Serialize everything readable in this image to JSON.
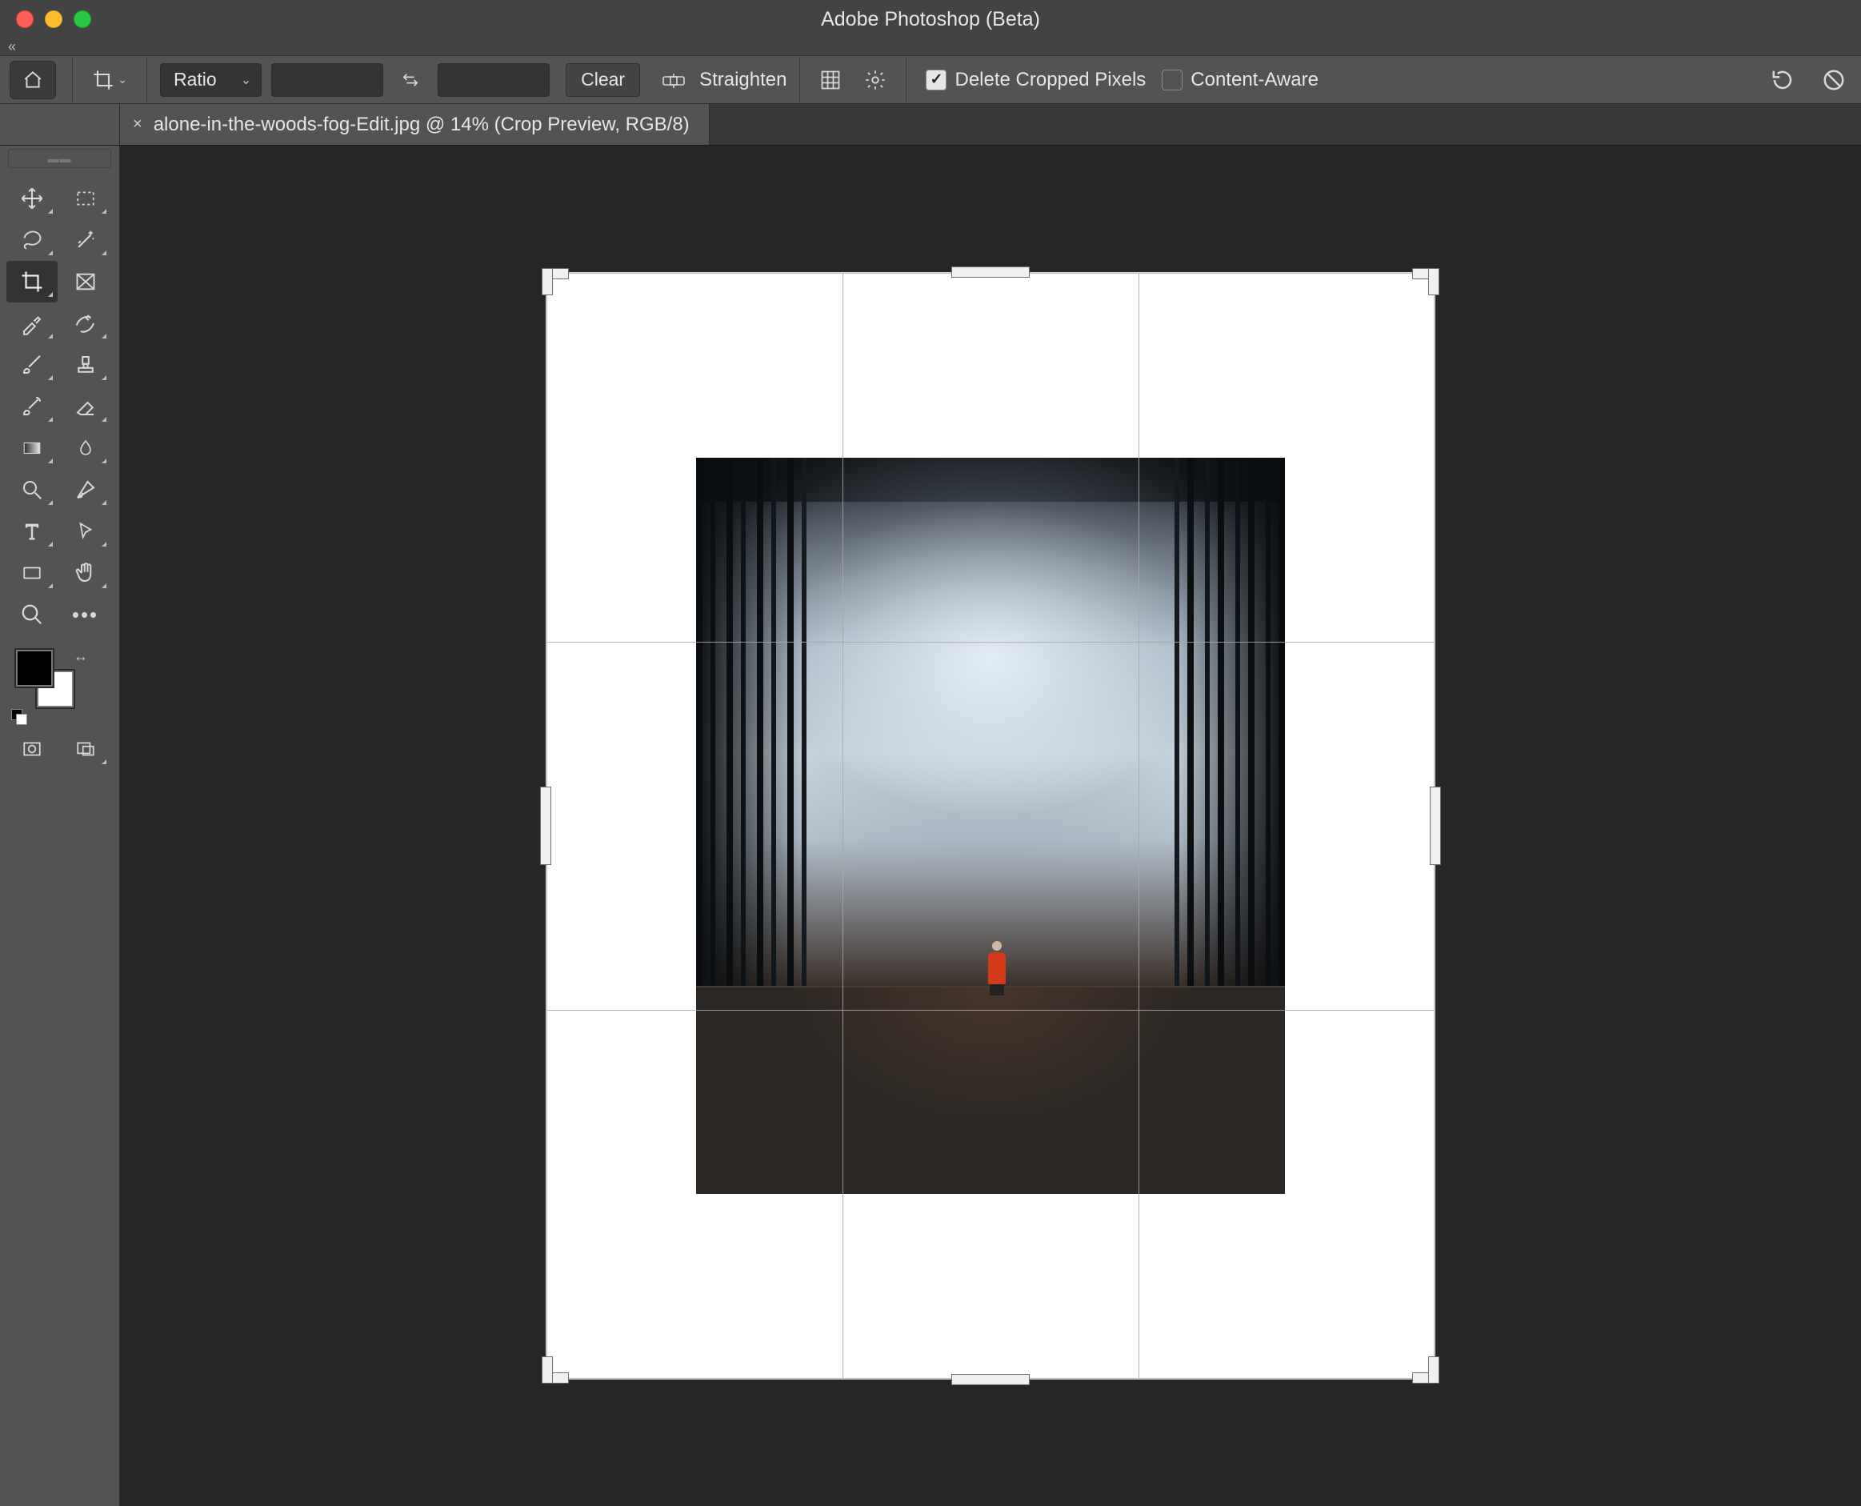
{
  "app": {
    "title": "Adobe Photoshop (Beta)"
  },
  "options": {
    "ratio_label": "Ratio",
    "width_value": "",
    "height_value": "",
    "clear_label": "Clear",
    "straighten_label": "Straighten",
    "delete_cropped_label": "Delete Cropped Pixels",
    "delete_cropped_checked": true,
    "content_aware_label": "Content-Aware",
    "content_aware_checked": false
  },
  "tabs": [
    {
      "label": "alone-in-the-woods-fog-Edit.jpg @ 14% (Crop Preview, RGB/8)"
    }
  ],
  "collapsed_panel_label": "",
  "tools": [
    {
      "name": "move-tool",
      "flyout": true
    },
    {
      "name": "rectangular-marquee-tool",
      "flyout": true
    },
    {
      "name": "lasso-tool",
      "flyout": true
    },
    {
      "name": "magic-wand-tool",
      "flyout": true
    },
    {
      "name": "crop-tool",
      "flyout": true,
      "active": true
    },
    {
      "name": "frame-tool",
      "flyout": false
    },
    {
      "name": "eyedropper-tool",
      "flyout": true
    },
    {
      "name": "remove-tool",
      "flyout": true
    },
    {
      "name": "brush-tool",
      "flyout": true
    },
    {
      "name": "clone-stamp-tool",
      "flyout": true
    },
    {
      "name": "history-brush-tool",
      "flyout": true
    },
    {
      "name": "eraser-tool",
      "flyout": true
    },
    {
      "name": "gradient-tool",
      "flyout": true
    },
    {
      "name": "blur-tool",
      "flyout": true
    },
    {
      "name": "dodge-tool",
      "flyout": true
    },
    {
      "name": "pen-tool",
      "flyout": true
    },
    {
      "name": "type-tool",
      "flyout": true
    },
    {
      "name": "path-selection-tool",
      "flyout": true
    },
    {
      "name": "rectangle-tool",
      "flyout": true
    },
    {
      "name": "hand-tool",
      "flyout": true
    },
    {
      "name": "zoom-tool",
      "flyout": false
    },
    {
      "name": "more-tools",
      "flyout": false
    }
  ],
  "colors": {
    "foreground": "#000000",
    "background": "#ffffff"
  },
  "canvas": {
    "zoom_label": "14%",
    "color_mode": "RGB/8",
    "view": "Crop Preview"
  }
}
